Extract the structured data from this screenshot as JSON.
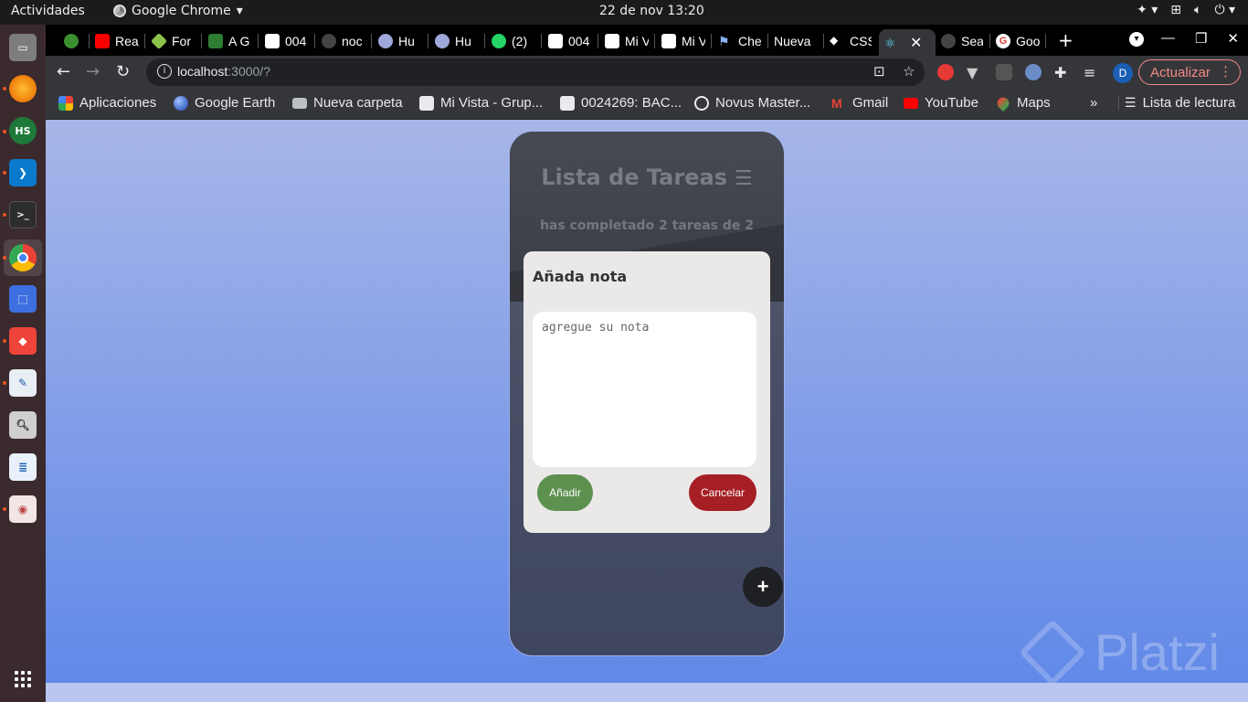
{
  "topbar": {
    "activities": "Actividades",
    "app_name": "Google Chrome",
    "clock": "22 de nov  13:20",
    "tray_icons": [
      "accessibility-icon",
      "network-icon",
      "volume-icon",
      "power-icon"
    ]
  },
  "dock": {
    "items": [
      "files",
      "firefox",
      "hs",
      "vscode",
      "terminal",
      "chrome",
      "screenshot",
      "anydesk",
      "text-editor",
      "image-viewer",
      "writer",
      "document-viewer"
    ]
  },
  "tabs": [
    {
      "label": "",
      "color": "#3a8f2f"
    },
    {
      "label": "Rea",
      "color": "#ff0000"
    },
    {
      "label": "For",
      "color": "#8bc34a"
    },
    {
      "label": "A G",
      "color": "#2e7d32"
    },
    {
      "label": "004",
      "color": "#ffffff"
    },
    {
      "label": "noc",
      "color": "#444444"
    },
    {
      "label": "Hu",
      "color": "#9fa8da"
    },
    {
      "label": "Hu",
      "color": "#9fa8da"
    },
    {
      "label": "(2)",
      "color": "#25d366"
    },
    {
      "label": "004",
      "color": "#ffffff"
    },
    {
      "label": "Mi V",
      "color": "#ffffff"
    },
    {
      "label": "Mi V",
      "color": "#ffffff"
    },
    {
      "label": "Che",
      "color": "#8ab4f8"
    },
    {
      "label": "Nueva",
      "color": "#35363a"
    },
    {
      "label": "CSS",
      "color": "#ffffff"
    },
    {
      "label": "",
      "color": "#61dafb",
      "active": true
    },
    {
      "label": "Sea",
      "color": "#444444"
    },
    {
      "label": "Goo",
      "color": "#ea4335"
    }
  ],
  "toolbar": {
    "url_host": "localhost",
    "url_rest": ":3000/?",
    "update_label": "Actualizar",
    "profile_initial": "D"
  },
  "bookmarks": [
    {
      "label": "Aplicaciones",
      "icon": "apps-grid-icon",
      "color": "#ea4335"
    },
    {
      "label": "Google Earth",
      "icon": "earth-icon",
      "color": "#4a8af4"
    },
    {
      "label": "Nueva carpeta",
      "icon": "folder-icon",
      "color": "#bdc1c6"
    },
    {
      "label": "Mi Vista - Grup...",
      "icon": "puzzle-icon",
      "color": "#e8eaed"
    },
    {
      "label": "0024269: BAC...",
      "icon": "puzzle-icon",
      "color": "#e8eaed"
    },
    {
      "label": "Novus Master...",
      "icon": "eye-icon",
      "color": "#e8eaed"
    },
    {
      "label": "Gmail",
      "icon": "gmail-icon",
      "color": "#ea4335"
    },
    {
      "label": "YouTube",
      "icon": "youtube-icon",
      "color": "#ff0000"
    },
    {
      "label": "Maps",
      "icon": "maps-icon",
      "color": "#34a853"
    }
  ],
  "reading_list": "Lista de lectura",
  "app": {
    "title": "Lista de Tareas",
    "counter": "has completado 2 tareas de 2",
    "fab_label": "+"
  },
  "modal": {
    "title": "Añada nota",
    "placeholder": "agregue su nota",
    "add_label": "Añadir",
    "cancel_label": "Cancelar"
  },
  "watermark": "Platzi"
}
